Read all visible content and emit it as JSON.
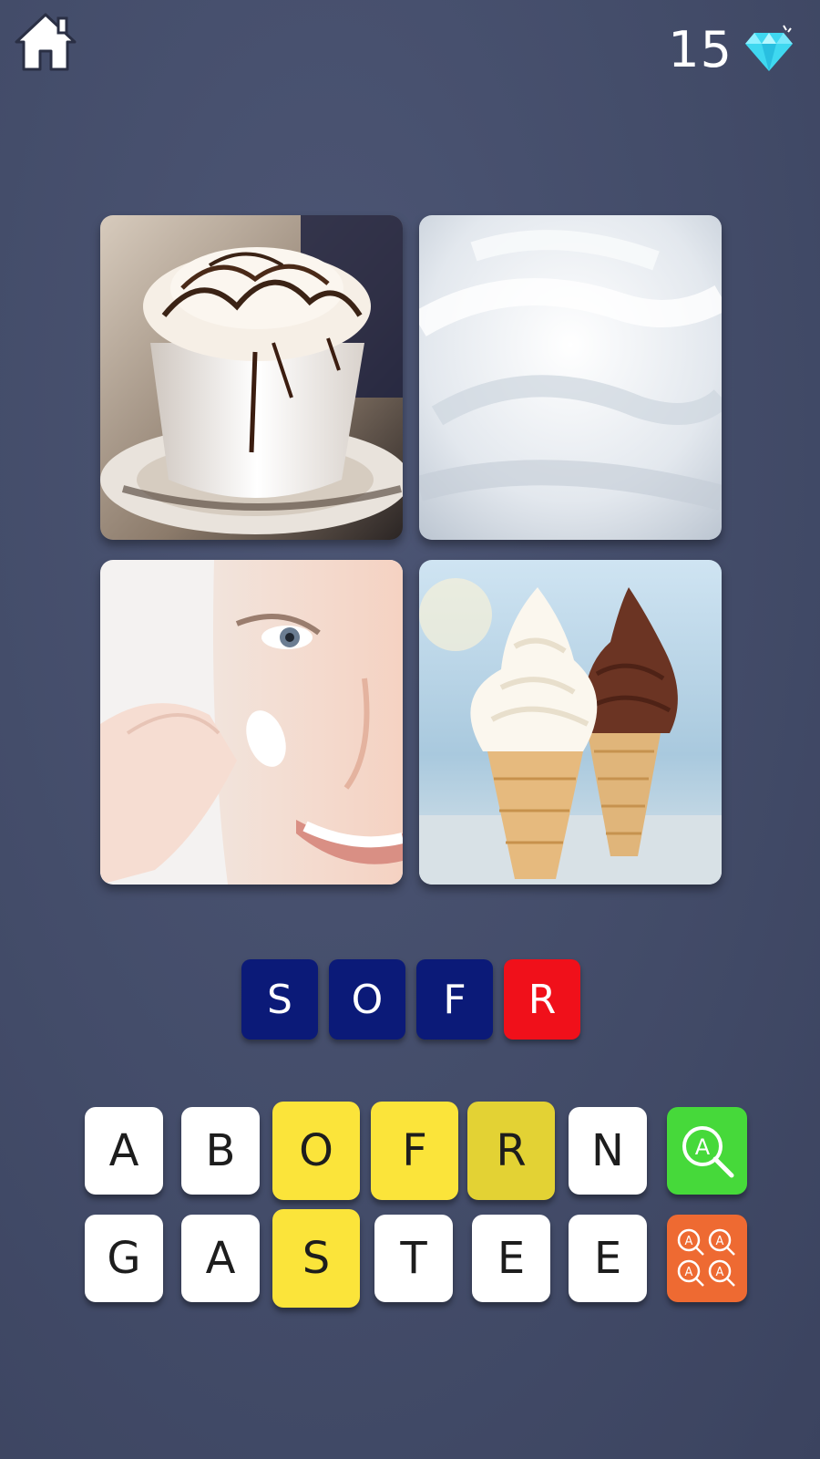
{
  "header": {
    "home_icon": "home-icon",
    "gem_count": "15",
    "gem_icon": "diamond-icon"
  },
  "photos": [
    {
      "subject": "whipped-cream-coffee"
    },
    {
      "subject": "white-fur"
    },
    {
      "subject": "face-cream"
    },
    {
      "subject": "soft-serve-ice-cream"
    }
  ],
  "answer": {
    "slots": [
      {
        "letter": "S",
        "state": "filled"
      },
      {
        "letter": "O",
        "state": "filled"
      },
      {
        "letter": "F",
        "state": "filled"
      },
      {
        "letter": "R",
        "state": "wrong"
      }
    ]
  },
  "keyboard": {
    "row1": [
      {
        "letter": "A",
        "state": "available"
      },
      {
        "letter": "B",
        "state": "available"
      },
      {
        "letter": "O",
        "state": "used"
      },
      {
        "letter": "F",
        "state": "used"
      },
      {
        "letter": "R",
        "state": "used"
      },
      {
        "letter": "N",
        "state": "available"
      }
    ],
    "row2": [
      {
        "letter": "G",
        "state": "available"
      },
      {
        "letter": "A",
        "state": "available"
      },
      {
        "letter": "S",
        "state": "used"
      },
      {
        "letter": "T",
        "state": "available"
      },
      {
        "letter": "E",
        "state": "available"
      },
      {
        "letter": "E",
        "state": "available"
      }
    ],
    "hint_reveal_icon": "magnifier-letter-icon",
    "hint_remove_icon": "multi-magnifier-icon"
  },
  "colors": {
    "background": "#434c69",
    "slot": "#0b1a78",
    "slot_wrong": "#f0101a",
    "tile": "#ffffff",
    "tile_used": "#fbe43a",
    "hint_reveal": "#46d93a",
    "hint_remove": "#ee6a32",
    "gem": "#3fd8f0"
  }
}
